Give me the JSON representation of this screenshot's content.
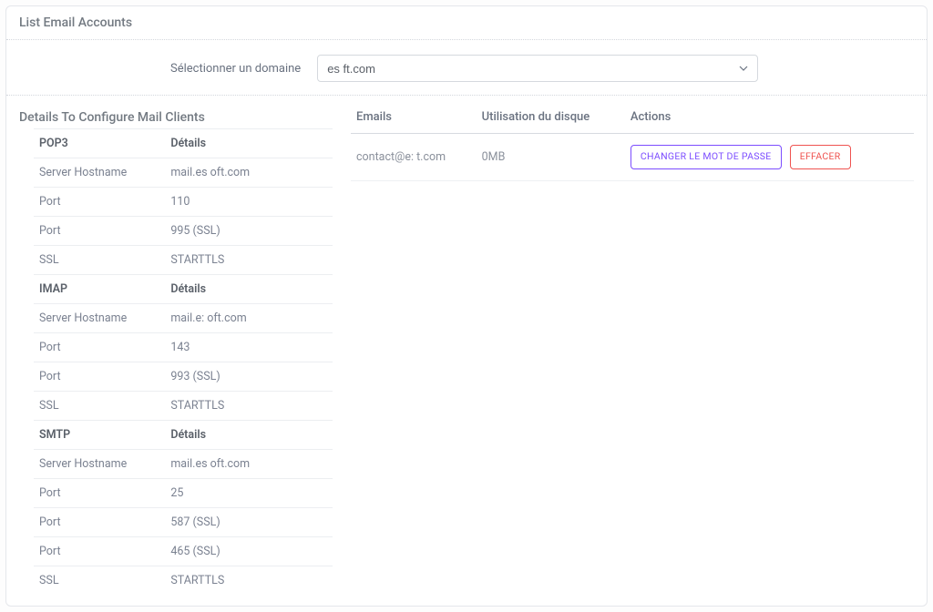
{
  "header": {
    "title": "List Email Accounts"
  },
  "domain": {
    "label": "Sélectionner un domaine",
    "selected": "es         ft.com"
  },
  "config": {
    "title": "Details To Configure Mail Clients",
    "sections": [
      {
        "name": "POP3",
        "details_label": "Détails",
        "rows": [
          {
            "label": "Server Hostname",
            "value": "mail.es         oft.com"
          },
          {
            "label": "Port",
            "value": "110"
          },
          {
            "label": "Port",
            "value": "995 (SSL)"
          },
          {
            "label": "SSL",
            "value": "STARTTLS"
          }
        ]
      },
      {
        "name": "IMAP",
        "details_label": "Détails",
        "rows": [
          {
            "label": "Server Hostname",
            "value": "mail.e:         oft.com"
          },
          {
            "label": "Port",
            "value": "143"
          },
          {
            "label": "Port",
            "value": "993 (SSL)"
          },
          {
            "label": "SSL",
            "value": "STARTTLS"
          }
        ]
      },
      {
        "name": "SMTP",
        "details_label": "Détails",
        "rows": [
          {
            "label": "Server Hostname",
            "value": "mail.es         oft.com"
          },
          {
            "label": "Port",
            "value": "25"
          },
          {
            "label": "Port",
            "value": "587 (SSL)"
          },
          {
            "label": "Port",
            "value": "465 (SSL)"
          },
          {
            "label": "SSL",
            "value": "STARTTLS"
          }
        ]
      }
    ]
  },
  "emails_table": {
    "headers": {
      "emails": "Emails",
      "disk": "Utilisation du disque",
      "actions": "Actions"
    },
    "rows": [
      {
        "email": "contact@e:         t.com",
        "disk": "0MB"
      }
    ],
    "actions": {
      "change_password": "CHANGER LE MOT DE PASSE",
      "delete": "EFFACER"
    }
  }
}
